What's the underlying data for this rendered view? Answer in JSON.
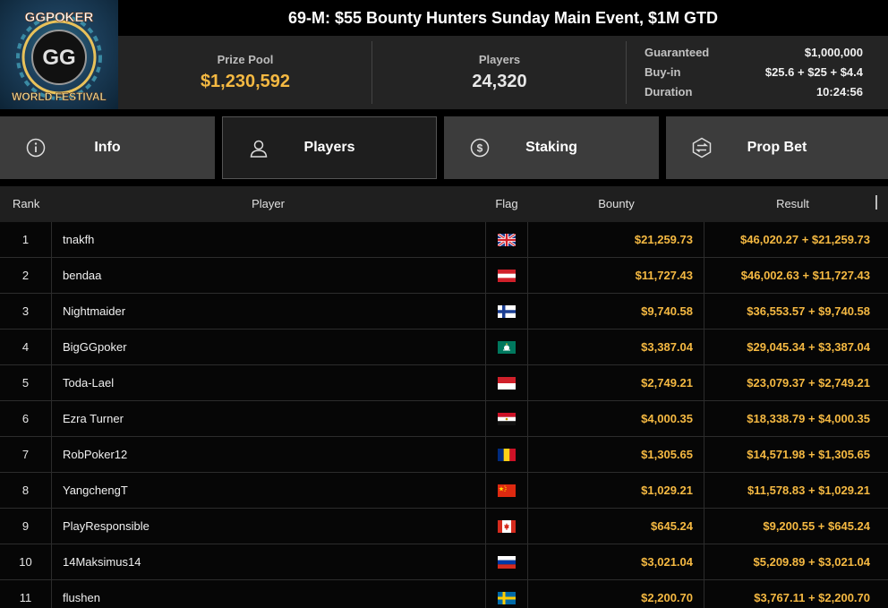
{
  "logo": {
    "top_text": "GGPOKER",
    "bottom_text": "WORLD FESTIVAL",
    "center_text": "GG"
  },
  "title": "69-M: $55 Bounty Hunters Sunday Main Event, $1M GTD",
  "stats": {
    "prize_pool_label": "Prize Pool",
    "prize_pool_value": "$1,230,592",
    "players_label": "Players",
    "players_value": "24,320"
  },
  "details": [
    {
      "key": "Guaranteed",
      "value": "$1,000,000"
    },
    {
      "key": "Buy-in",
      "value": "$25.6 + $25 + $4.4"
    },
    {
      "key": "Duration",
      "value": "10:24:56"
    }
  ],
  "tabs": [
    {
      "label": "Info",
      "icon": "info-icon",
      "active": false
    },
    {
      "label": "Players",
      "icon": "user-icon",
      "active": true
    },
    {
      "label": "Staking",
      "icon": "dollar-coin-icon",
      "active": false
    },
    {
      "label": "Prop Bet",
      "icon": "prop-bet-icon",
      "active": false
    }
  ],
  "table": {
    "headers": {
      "rank": "Rank",
      "player": "Player",
      "flag": "Flag",
      "bounty": "Bounty",
      "result": "Result"
    },
    "rows": [
      {
        "rank": "1",
        "player": "tnakfh",
        "flag": "uk",
        "bounty": "$21,259.73",
        "result": "$46,020.27 + $21,259.73"
      },
      {
        "rank": "2",
        "player": "bendaa",
        "flag": "austria",
        "bounty": "$11,727.43",
        "result": "$46,002.63 + $11,727.43"
      },
      {
        "rank": "3",
        "player": "Nightmaider",
        "flag": "finland",
        "bounty": "$9,740.58",
        "result": "$36,553.57 + $9,740.58"
      },
      {
        "rank": "4",
        "player": "BigGGpoker",
        "flag": "macau",
        "bounty": "$3,387.04",
        "result": "$29,045.34 + $3,387.04"
      },
      {
        "rank": "5",
        "player": "Toda-Lael",
        "flag": "indonesia",
        "bounty": "$2,749.21",
        "result": "$23,079.37 + $2,749.21"
      },
      {
        "rank": "6",
        "player": "Ezra Turner",
        "flag": "egypt",
        "bounty": "$4,000.35",
        "result": "$18,338.79 + $4,000.35"
      },
      {
        "rank": "7",
        "player": "RobPoker12",
        "flag": "romania",
        "bounty": "$1,305.65",
        "result": "$14,571.98 + $1,305.65"
      },
      {
        "rank": "8",
        "player": "YangchengT",
        "flag": "china",
        "bounty": "$1,029.21",
        "result": "$11,578.83 + $1,029.21"
      },
      {
        "rank": "9",
        "player": "PlayResponsible",
        "flag": "canada",
        "bounty": "$645.24",
        "result": "$9,200.55 + $645.24"
      },
      {
        "rank": "10",
        "player": "14Maksimus14",
        "flag": "russia",
        "bounty": "$3,021.04",
        "result": "$5,209.89 + $3,021.04"
      },
      {
        "rank": "11",
        "player": "flushen",
        "flag": "sweden",
        "bounty": "$2,200.70",
        "result": "$3,767.11 + $2,200.70"
      }
    ]
  },
  "colors": {
    "gold": "#f5b942",
    "background": "#000000",
    "tab": "#3c3c3c"
  }
}
